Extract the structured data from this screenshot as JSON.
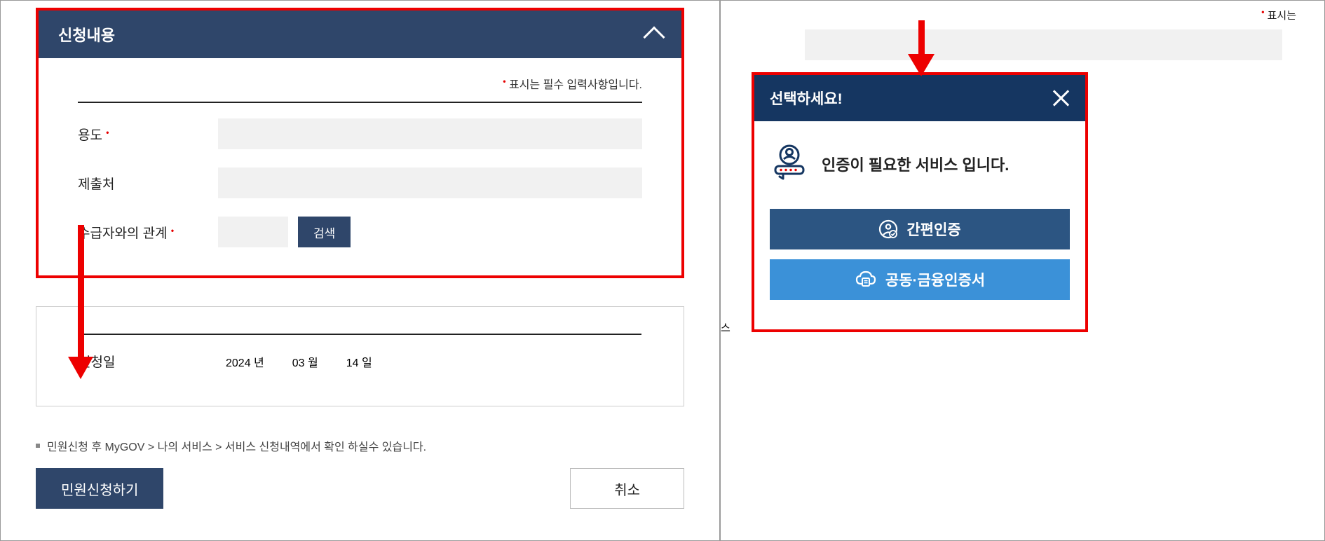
{
  "left": {
    "section_title": "신청내용",
    "required_note": "표시는 필수 입력사항입니다.",
    "labels": {
      "purpose": "용도",
      "submit_to": "제출처",
      "relationship": "수급자와의 관계"
    },
    "search_button": "검색",
    "date_section": {
      "label": "신청일",
      "year_val": "2024",
      "year_unit": "년",
      "month_val": "03",
      "month_unit": "월",
      "day_val": "14",
      "day_unit": "일"
    },
    "footer_note": "민원신청 후 MyGOV > 나의 서비스 > 서비스 신청내역에서 확인 하실수 있습니다.",
    "apply_button": "민원신청하기",
    "cancel_button": "취소"
  },
  "right": {
    "top_note": "표시는",
    "side_text": "스",
    "modal": {
      "title": "선택하세요!",
      "message": "인증이 필요한 서비스 입니다.",
      "option_simple": "간편인증",
      "option_cert": "공동·금융인증서"
    }
  },
  "colors": {
    "navy": "#2f466a",
    "deep_navy": "#153661",
    "option_dark": "#2c5582",
    "option_light": "#3b91d8",
    "highlight_red": "#ed0000"
  }
}
